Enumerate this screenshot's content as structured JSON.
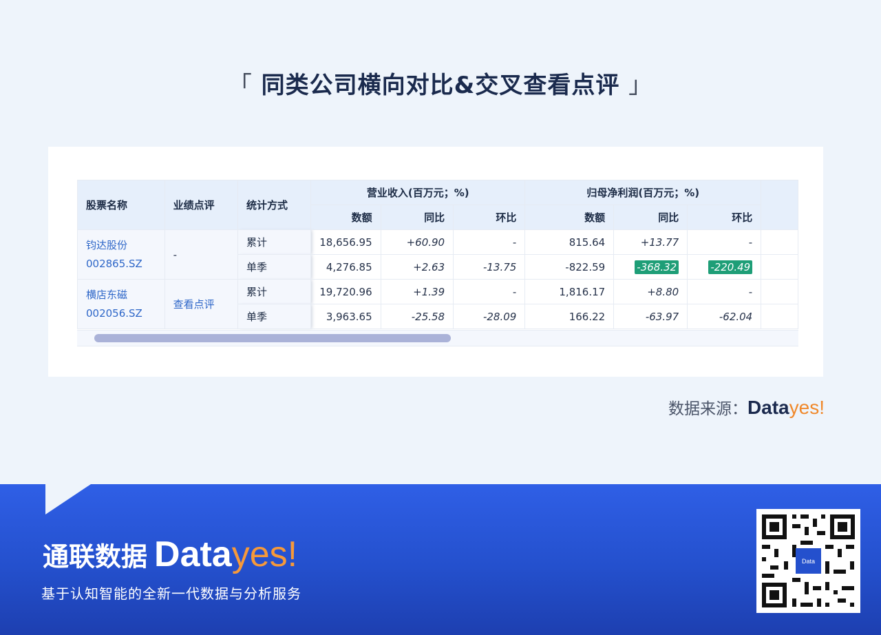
{
  "title": {
    "open": "「",
    "text": "同类公司横向对比&交叉查看点评",
    "close": "」"
  },
  "table": {
    "headers": {
      "stock_name": "股票名称",
      "review": "业绩点评",
      "method": "统计方式",
      "revenue_group": "营业收入(百万元；%)",
      "profit_group": "归母净利润(百万元；%)",
      "amount": "数额",
      "yoy": "同比",
      "qoq": "环比"
    },
    "companies": [
      {
        "name": "钧达股份",
        "code": "002865.SZ",
        "review": "-",
        "rows": [
          {
            "method": "累计",
            "rev_amount": "18,656.95",
            "rev_yoy": "+60.90",
            "rev_qoq": "-",
            "np_amount": "815.64",
            "np_yoy": "+13.77",
            "np_qoq": "-"
          },
          {
            "method": "单季",
            "rev_amount": "4,276.85",
            "rev_yoy": "+2.63",
            "rev_qoq": "-13.75",
            "np_amount": "-822.59",
            "np_yoy": "-368.32",
            "np_qoq": "-220.49"
          }
        ]
      },
      {
        "name": "横店东磁",
        "code": "002056.SZ",
        "review": "查看点评",
        "rows": [
          {
            "method": "累计",
            "rev_amount": "19,720.96",
            "rev_yoy": "+1.39",
            "rev_qoq": "-",
            "np_amount": "1,816.17",
            "np_yoy": "+8.80",
            "np_qoq": "-"
          },
          {
            "method": "单季",
            "rev_amount": "3,963.65",
            "rev_yoy": "-25.58",
            "rev_qoq": "-28.09",
            "np_amount": "166.22",
            "np_yoy": "-63.97",
            "np_qoq": "-62.04"
          }
        ]
      }
    ]
  },
  "source": {
    "label": "数据来源：",
    "brand_a": "Data",
    "brand_b": "yes!"
  },
  "footer": {
    "brand_cn": "通联数据",
    "brand_a": "Data",
    "brand_b": "yes!",
    "tagline": "基于认知智能的全新一代数据与分析服务"
  },
  "colors": {
    "accent_blue": "#2d66c8",
    "highlight_green": "#1e9e77",
    "brand_orange": "#f0882a",
    "footer_blue": "#2450cd"
  },
  "icons": {
    "qr": "qr-code-icon"
  }
}
